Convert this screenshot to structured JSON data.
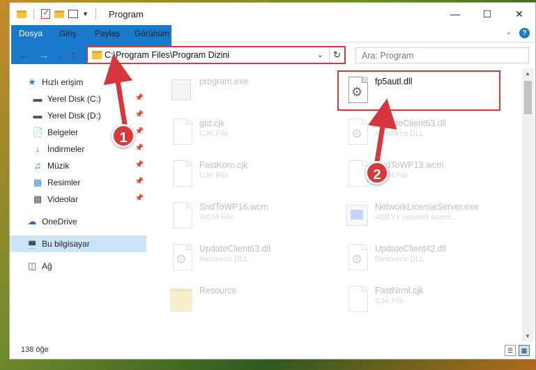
{
  "window": {
    "title": "Program"
  },
  "ribbon": {
    "tabs": [
      "Dosya",
      "Giriş",
      "Paylaş",
      "Görünüm"
    ],
    "help": "?"
  },
  "address": {
    "path": "C:\\Program Files\\Program Dizini",
    "search_placeholder": "Ara: Program"
  },
  "sidebar": {
    "items": [
      {
        "label": "Hızlı erişim",
        "icon": "star-icon"
      },
      {
        "label": "Yerel Disk (C:)",
        "icon": "drive-icon",
        "pinned": true
      },
      {
        "label": "Yerel Disk (D:)",
        "icon": "drive-icon",
        "pinned": true
      },
      {
        "label": "Belgeler",
        "icon": "documents-icon",
        "pinned": true
      },
      {
        "label": "İndirmeler",
        "icon": "download-icon",
        "pinned": true
      },
      {
        "label": "Müzik",
        "icon": "music-icon",
        "pinned": true
      },
      {
        "label": "Resimler",
        "icon": "pictures-icon",
        "pinned": true
      },
      {
        "label": "Videolar",
        "icon": "videos-icon",
        "pinned": true
      },
      {
        "label": "OneDrive",
        "icon": "cloud-icon"
      },
      {
        "label": "Bu bilgisayar",
        "icon": "computer-icon",
        "selected": true
      },
      {
        "label": "Ağ",
        "icon": "network-icon"
      }
    ]
  },
  "files": [
    {
      "name": "program.exe",
      "type": "",
      "icon": "exe-icon",
      "faded": true
    },
    {
      "name": "fp5autl.dll",
      "type": "",
      "icon": "dll-gear-icon",
      "faded": false
    },
    {
      "name": "gtd.cjk",
      "type": "CJK File",
      "icon": "file-icon",
      "faded": true
    },
    {
      "name": "UpdateClient63.dll",
      "type": "Resource DLL",
      "icon": "dll-gear-icon",
      "faded": true
    },
    {
      "name": "FastKorn.cjk",
      "type": "CJK File",
      "icon": "file-icon",
      "faded": true
    },
    {
      "name": "SndToWP13.wcm",
      "type": "WCM File",
      "icon": "file-icon",
      "faded": true
    },
    {
      "name": "SndToWP16.wcm",
      "type": "WCM File",
      "icon": "file-icon",
      "faded": true
    },
    {
      "name": "NetworkLicenseServer.exe",
      "type": "ABBYY network licens...",
      "icon": "app-icon",
      "faded": true
    },
    {
      "name": "UpdateClient63.dll",
      "type": "Resource DLL",
      "icon": "dll-gear-icon",
      "faded": true
    },
    {
      "name": "UpdateClient42.dll",
      "type": "Resource DLL",
      "icon": "dll-gear-icon",
      "faded": true
    },
    {
      "name": "Resource",
      "type": "",
      "icon": "folder-icon",
      "faded": true
    },
    {
      "name": "FastNrml.cjk",
      "type": "CJK File",
      "icon": "file-icon",
      "faded": true
    }
  ],
  "status": {
    "count": "138 öğe"
  },
  "annotations": {
    "badge1": "1",
    "badge2": "2",
    "color": "#d6363d"
  }
}
